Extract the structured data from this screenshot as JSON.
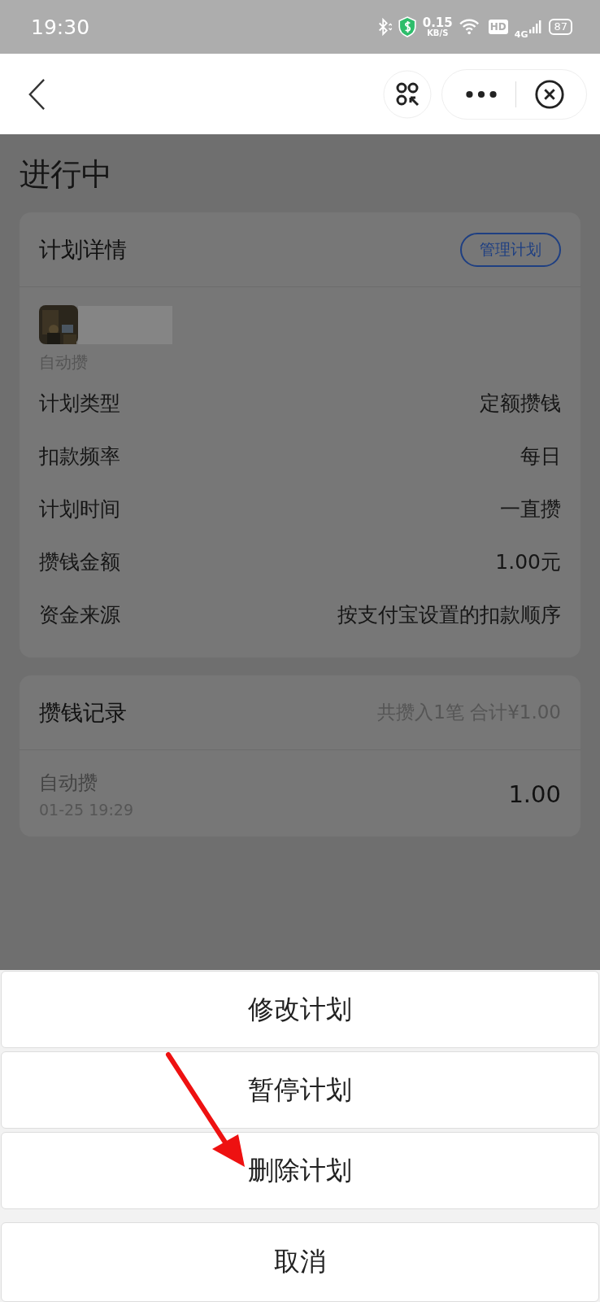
{
  "status_bar": {
    "time": "19:30",
    "net_speed": "0.15",
    "net_unit": "KB/S",
    "hd": "HD",
    "network": "4G",
    "battery": "87"
  },
  "page_title": "进行中",
  "plan_card": {
    "title": "计划详情",
    "manage_button": "管理计划",
    "subtitle": "自动攒",
    "rows": [
      {
        "label": "计划类型",
        "value": "定额攒钱"
      },
      {
        "label": "扣款频率",
        "value": "每日"
      },
      {
        "label": "计划时间",
        "value": "一直攒"
      },
      {
        "label": "攒钱金额",
        "value": "1.00元"
      },
      {
        "label": "资金来源",
        "value": "按支付宝设置的扣款顺序"
      }
    ]
  },
  "records_card": {
    "title": "攒钱记录",
    "summary": "共攒入1笔 合计¥1.00",
    "records": [
      {
        "name": "自动攒",
        "time": "01-25 19:29",
        "amount": "1.00"
      }
    ]
  },
  "action_sheet": {
    "actions": [
      "修改计划",
      "暂停计划",
      "删除计划"
    ],
    "cancel": "取消"
  }
}
